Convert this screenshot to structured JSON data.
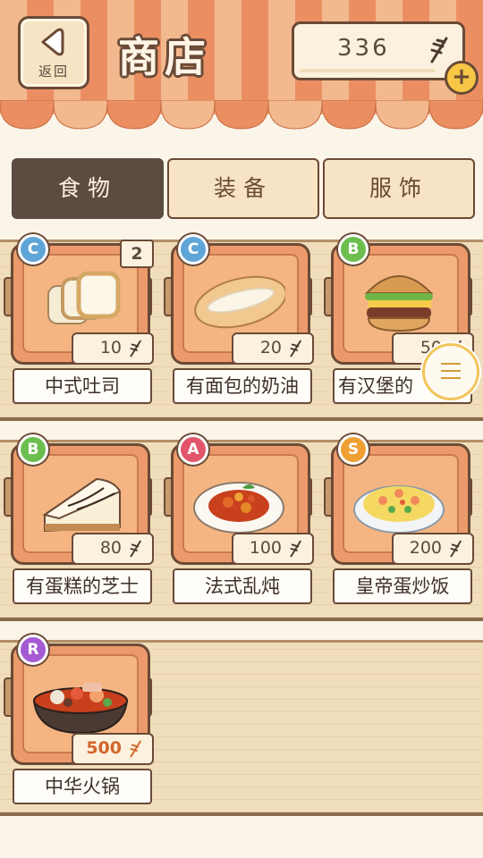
{
  "header": {
    "back_label": "返回",
    "title": "商店",
    "coins": "336",
    "plus_label": "+"
  },
  "tabs": [
    {
      "label": "食物",
      "active": true
    },
    {
      "label": "装备",
      "active": false
    },
    {
      "label": "服饰",
      "active": false
    }
  ],
  "items": [
    {
      "name": "中式吐司",
      "grade": "C",
      "price": "10",
      "count": "2",
      "icon": "toast-icon"
    },
    {
      "name": "有面包的奶油",
      "grade": "C",
      "price": "20",
      "icon": "cream-bun-icon"
    },
    {
      "name": "有汉堡的",
      "grade": "B",
      "price": "50",
      "icon": "burger-icon"
    },
    {
      "name": "有蛋糕的芝士",
      "grade": "B",
      "price": "80",
      "icon": "cheesecake-icon"
    },
    {
      "name": "法式乱炖",
      "grade": "A",
      "price": "100",
      "icon": "ratatouille-icon"
    },
    {
      "name": "皇帝蛋炒饭",
      "grade": "S",
      "price": "200",
      "icon": "fried-rice-icon"
    },
    {
      "name": "中华火锅",
      "grade": "R",
      "price": "500",
      "icon": "hotpot-icon"
    }
  ],
  "colors": {
    "awning_light": "#f2b98e",
    "awning_dark": "#eb8f63",
    "tab_active": "#5c4b40",
    "crate": "#ec9a6b",
    "outline": "#6a4a36"
  }
}
